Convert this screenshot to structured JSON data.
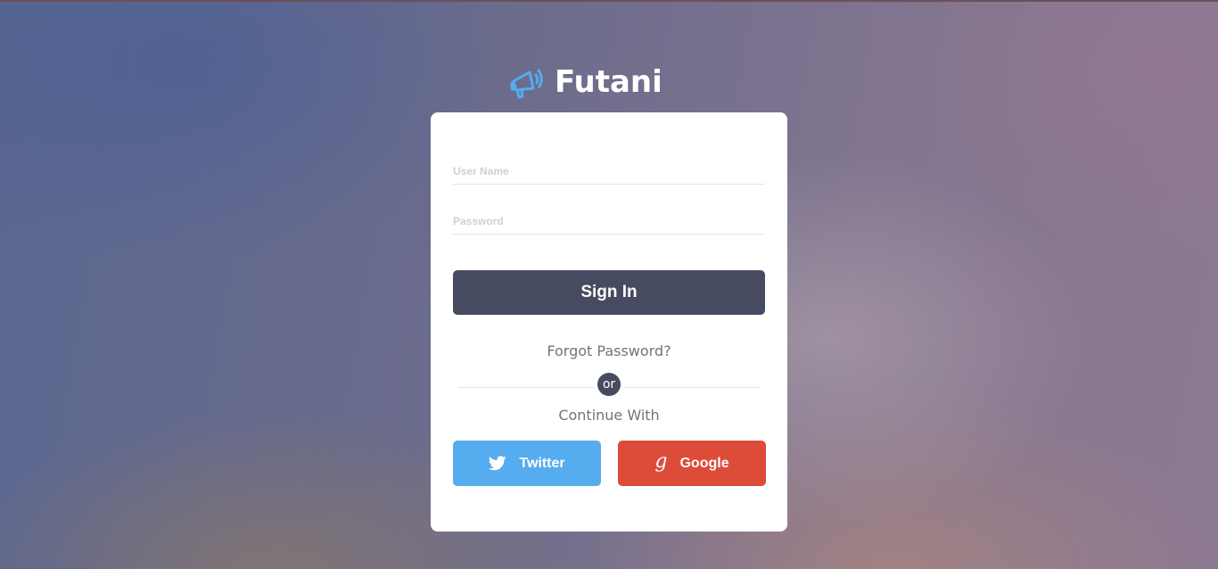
{
  "brand": {
    "name": "Futani",
    "logo_icon": "megaphone-icon",
    "logo_color": "#55acee"
  },
  "login_form": {
    "username": {
      "placeholder": "User Name",
      "value": ""
    },
    "password": {
      "placeholder": "Password",
      "value": ""
    },
    "signin_label": "Sign In",
    "signin_color": "#474b61",
    "forgot_label": "Forgot Password?",
    "or_label": "or",
    "continue_label": "Continue With"
  },
  "social": {
    "twitter": {
      "label": "Twitter",
      "icon": "twitter-bird-icon",
      "color": "#55acee"
    },
    "google": {
      "label": "Google",
      "icon": "google-g-icon",
      "icon_glyph": "g",
      "color": "#dd4b39"
    }
  }
}
